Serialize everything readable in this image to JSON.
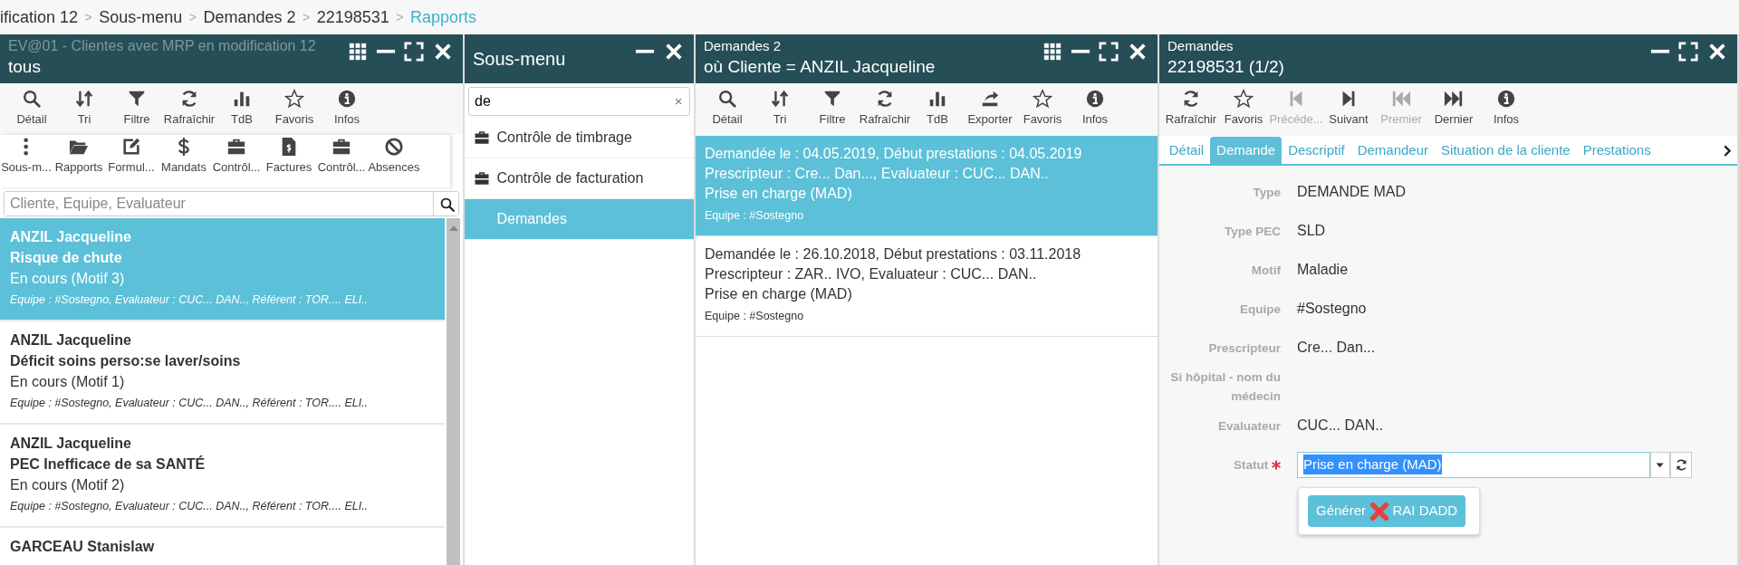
{
  "breadcrumb": {
    "separator": ">",
    "items": [
      {
        "label": "ification 12",
        "current": false
      },
      {
        "label": "Sous-menu",
        "current": false
      },
      {
        "label": "Demandes 2",
        "current": false
      },
      {
        "label": "22198531",
        "current": false
      },
      {
        "label": "Rapports",
        "current": true
      }
    ]
  },
  "panels": [
    {
      "kind": "list",
      "title": "EV@01 - Clientes avec MRP en modification 12",
      "title_dimmed": true,
      "subtitle": "tous",
      "window_buttons": [
        {
          "kind": "grid"
        },
        {
          "kind": "minimize"
        },
        {
          "kind": "maximize"
        },
        {
          "kind": "close"
        }
      ],
      "toolbar": [
        {
          "kind": "search",
          "label": "Détail"
        },
        {
          "kind": "sort",
          "label": "Tri"
        },
        {
          "kind": "filter",
          "label": "Filtre"
        },
        {
          "kind": "refresh",
          "label": "Rafraîchir"
        },
        {
          "kind": "chart",
          "label": "TdB"
        },
        {
          "kind": "star",
          "label": "Favoris"
        },
        {
          "kind": "info",
          "label": "Infos"
        }
      ],
      "toolbar_2": [
        {
          "kind": "dots",
          "label": "Sous-m..."
        },
        {
          "kind": "folder",
          "label": "Rapports"
        },
        {
          "kind": "edit",
          "label": "Formul..."
        },
        {
          "kind": "dollar",
          "label": "Mandats"
        },
        {
          "kind": "briefcase",
          "label": "Contrôl..."
        },
        {
          "kind": "invoice",
          "label": "Factures"
        },
        {
          "kind": "briefcase",
          "label": "Contrôl..."
        },
        {
          "kind": "ban",
          "label": "Absences"
        }
      ],
      "search": {
        "placeholder": "Cliente, Equipe, Evaluateur"
      },
      "items": [
        {
          "selected": true,
          "name": "ANZIL Jacqueline",
          "title": "Risque de chute",
          "status": "En cours (Motif 3)",
          "details": "Equipe : #Sostegno, Evaluateur : CUC... DAN.., Référent : TOR.... ELI.."
        },
        {
          "selected": false,
          "name": "ANZIL Jacqueline",
          "title": "Déficit soins perso:se laver/soins",
          "status": "En cours (Motif 1)",
          "details": "Equipe : #Sostegno, Evaluateur : CUC... DAN.., Référent : TOR.... ELI.."
        },
        {
          "selected": false,
          "name": "ANZIL Jacqueline",
          "title": "PEC Inefficace de sa SANTÉ",
          "status": "En cours (Motif 2)",
          "details": "Equipe : #Sostegno, Evaluateur : CUC... DAN.., Référent : TOR.... ELI.."
        },
        {
          "selected": false,
          "name": "GARCEAU Stanislaw"
        }
      ]
    },
    {
      "kind": "menu",
      "title": "Sous-menu",
      "window_buttons": [
        {
          "kind": "minimize"
        },
        {
          "kind": "close"
        }
      ],
      "search": {
        "value": "de",
        "clear": "×"
      },
      "items": [
        {
          "kind": "briefcase",
          "label": "Contrôle de timbrage",
          "selected": false
        },
        {
          "kind": "briefcase",
          "label": "Contrôle de facturation",
          "selected": false
        },
        {
          "kind": "plain",
          "label": "Demandes",
          "selected": true
        }
      ]
    },
    {
      "kind": "records",
      "title": "Demandes 2",
      "title_dimmed": false,
      "subtitle": "où Cliente = ANZIL Jacqueline",
      "window_buttons": [
        {
          "kind": "grid"
        },
        {
          "kind": "minimize"
        },
        {
          "kind": "maximize"
        },
        {
          "kind": "close"
        }
      ],
      "toolbar": [
        {
          "kind": "search",
          "label": "Détail"
        },
        {
          "kind": "sort",
          "label": "Tri"
        },
        {
          "kind": "filter",
          "label": "Filtre"
        },
        {
          "kind": "refresh",
          "label": "Rafraîchir"
        },
        {
          "kind": "chart",
          "label": "TdB"
        },
        {
          "kind": "export",
          "label": "Exporter"
        },
        {
          "kind": "star",
          "label": "Favoris"
        },
        {
          "kind": "info",
          "label": "Infos"
        }
      ],
      "items": [
        {
          "selected": true,
          "lines": [
            "Demandée le : 04.05.2019, Début prestations : 04.05.2019",
            "Prescripteur : Cre... Dan..., Evaluateur : CUC... DAN..",
            "Prise en charge (MAD)"
          ],
          "details": "Equipe : #Sostegno"
        },
        {
          "selected": false,
          "lines": [
            "Demandée le : 26.10.2018, Début prestations : 03.11.2018",
            "Prescripteur : ZAR.. IVO, Evaluateur : CUC... DAN..",
            "Prise en charge (MAD)"
          ],
          "details": "Equipe : #Sostegno"
        }
      ]
    },
    {
      "kind": "detail",
      "title": "Demandes",
      "title_dimmed": false,
      "subtitle": "22198531 (1/2)",
      "window_buttons": [
        {
          "kind": "minimize"
        },
        {
          "kind": "maximize"
        },
        {
          "kind": "close"
        }
      ],
      "toolbar": [
        {
          "kind": "refresh",
          "label": "Rafraîchir",
          "disabled": false
        },
        {
          "kind": "star",
          "label": "Favoris",
          "disabled": false
        },
        {
          "kind": "step-back",
          "label": "Précéde...",
          "disabled": true
        },
        {
          "kind": "step-forward",
          "label": "Suivant",
          "disabled": false
        },
        {
          "kind": "fast-back",
          "label": "Premier",
          "disabled": true
        },
        {
          "kind": "fast-forward",
          "label": "Dernier",
          "disabled": false
        },
        {
          "kind": "info",
          "label": "Infos",
          "disabled": false
        }
      ],
      "tabs": [
        {
          "label": "Détail",
          "selected": false
        },
        {
          "label": "Demande",
          "selected": true
        },
        {
          "label": "Descriptif",
          "selected": false
        },
        {
          "label": "Demandeur",
          "selected": false
        },
        {
          "label": "Situation de la cliente",
          "selected": false
        },
        {
          "label": "Prestations",
          "selected": false
        }
      ],
      "fields": [
        {
          "kind": "text",
          "label": "Type",
          "value": "DEMANDE MAD"
        },
        {
          "kind": "text",
          "label": "Type PEC",
          "value": "SLD"
        },
        {
          "kind": "text",
          "label": "Motif",
          "value": "Maladie"
        },
        {
          "kind": "text",
          "label": "Equipe",
          "value": "#Sostegno"
        },
        {
          "kind": "text",
          "label": "Prescripteur",
          "value": "Cre... Dan..."
        },
        {
          "kind": "text",
          "label": "Si hôpital - nom du médecin"
        },
        {
          "kind": "text",
          "label": "Evaluateur",
          "value": "CUC... DAN.."
        },
        {
          "kind": "select",
          "label": "Statut",
          "required": true,
          "value": "Prise en charge (MAD)",
          "text_selected": true
        }
      ],
      "popup": {
        "button_start": "Générer",
        "button_end": "RAI DADD"
      }
    }
  ]
}
